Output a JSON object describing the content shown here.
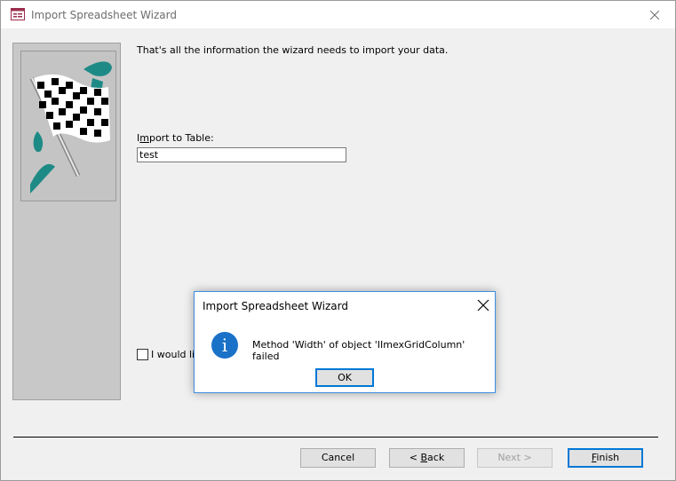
{
  "window": {
    "title": "Import Spreadsheet Wizard",
    "intro_text": "That's all the information the wizard needs to import your data.",
    "import_label_prefix": "I",
    "import_label_mnemonic": "m",
    "import_label_rest": "port to Table:",
    "table_name_value": "test",
    "checkbox_label": "I would lik",
    "buttons": {
      "cancel": "Cancel",
      "back_prefix": "< ",
      "back_mnemonic": "B",
      "back_rest": "ack",
      "next": "Next >",
      "finish_mnemonic": "F",
      "finish_rest": "inish"
    }
  },
  "dialog": {
    "title": "Import Spreadsheet Wizard",
    "message": "Method 'Width' of object 'IImexGridColumn' failed",
    "ok_label": "OK",
    "icon": "info-icon"
  },
  "colors": {
    "accent": "#0078d7",
    "info_icon": "#1a71c8",
    "flag_teal": "#1e8a86"
  }
}
